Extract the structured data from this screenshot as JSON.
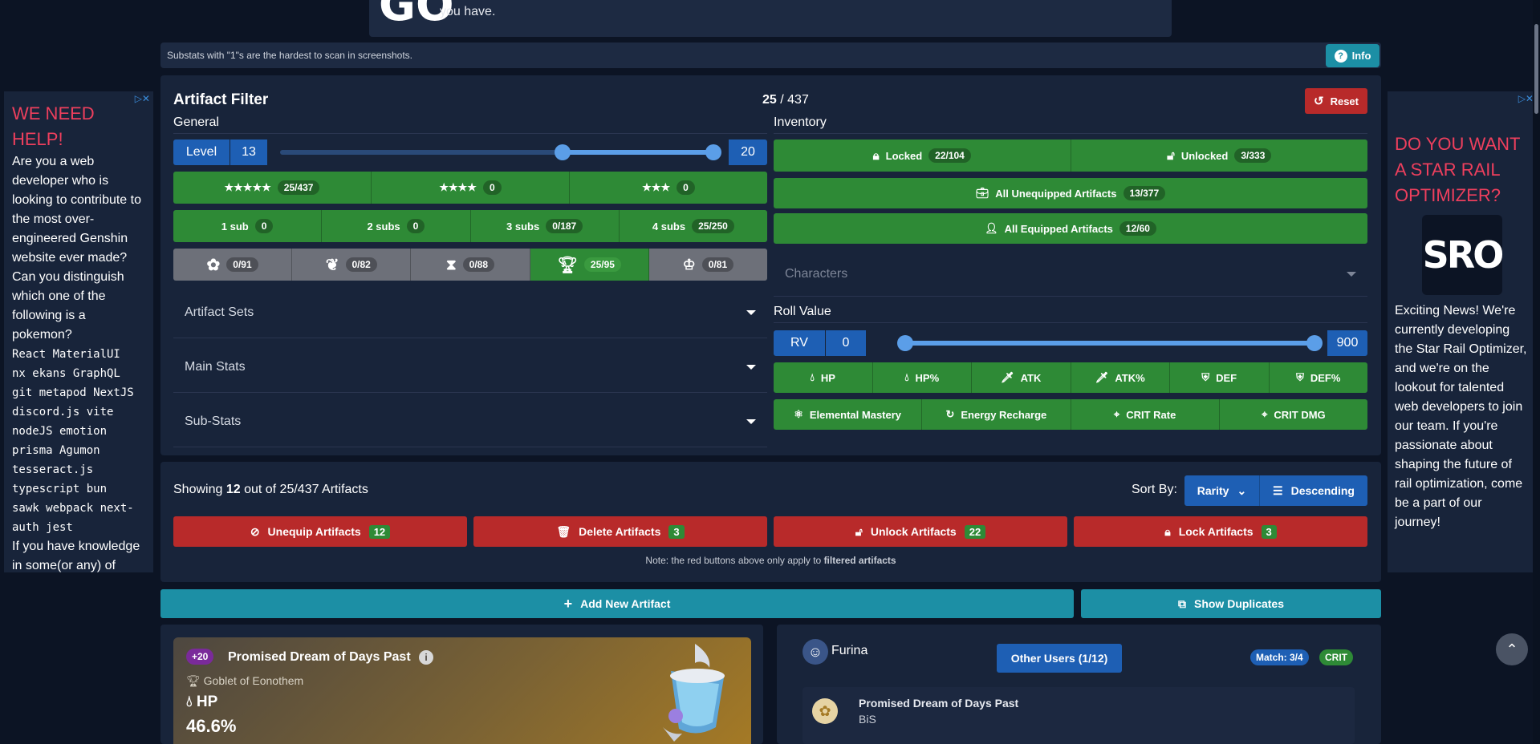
{
  "top_card": {
    "big_text": "GO",
    "text": "you have."
  },
  "alert": {
    "text": "Substats with \"1\"s are the hardest to scan in screenshots.",
    "info_label": "Info"
  },
  "ad_left": {
    "title": "WE NEED HELP!",
    "body": "Are you a web developer who is looking to contribute to the most over-engineered Genshin website ever made? Can you distinguish which one of the following is a pokemon?",
    "mono": [
      "React MaterialUI",
      "nx ekans GraphQL",
      "git metapod NextJS",
      "discord.js vite",
      "nodeJS emotion",
      "prisma Agumon",
      "tesseract.js",
      "typescript bun",
      "sawk webpack next-",
      "auth jest"
    ],
    "tail": "If you have knowledge in some(or any) of"
  },
  "ad_right": {
    "title": "DO YOU WANT A STAR RAIL OPTIMIZER?",
    "logo": "SRO",
    "body": "Exciting News! We're currently developing the Star Rail Optimizer, and we're on the lookout for talented web developers to join our team. If you're passionate about shaping the future of rail optimization, come be a part of our journey!"
  },
  "filter": {
    "title": "Artifact Filter",
    "count_shown": "25",
    "count_sep": " / ",
    "count_total": "437",
    "reset_label": "Reset",
    "general_label": "General",
    "inventory_label": "Inventory",
    "level": {
      "label": "Level",
      "min": "13",
      "max": "20",
      "range_min": 0,
      "range_max": 20
    },
    "rarity": [
      {
        "stars": "★★★★★",
        "count": "25/437"
      },
      {
        "stars": "★★★★",
        "count": "0"
      },
      {
        "stars": "★★★",
        "count": "0"
      }
    ],
    "subs": [
      {
        "label": "1 sub",
        "count": "0"
      },
      {
        "label": "2 subs",
        "count": "0"
      },
      {
        "label": "3 subs",
        "count": "0/187"
      },
      {
        "label": "4 subs",
        "count": "25/250"
      }
    ],
    "slots": [
      {
        "icon": "flower-icon",
        "count": "0/91"
      },
      {
        "icon": "plume-icon",
        "count": "0/82"
      },
      {
        "icon": "sands-icon",
        "count": "0/88"
      },
      {
        "icon": "goblet-icon",
        "count": "25/95"
      },
      {
        "icon": "circlet-icon",
        "count": "0/81"
      }
    ],
    "dropdowns": [
      "Artifact Sets",
      "Main Stats",
      "Sub-Stats"
    ],
    "locked": {
      "label": "Locked",
      "count": "22/104"
    },
    "unlocked": {
      "label": "Unlocked",
      "count": "3/333"
    },
    "unequipped": {
      "label": "All Unequipped Artifacts",
      "count": "13/377"
    },
    "equipped": {
      "label": "All Equipped Artifacts",
      "count": "12/60"
    },
    "characters_placeholder": "Characters",
    "roll_value": {
      "label": "Roll Value",
      "tag": "RV",
      "min": "0",
      "max": "900",
      "range_min": 0,
      "range_max": 900
    },
    "stats_row1": [
      "HP",
      "HP%",
      "ATK",
      "ATK%",
      "DEF",
      "DEF%"
    ],
    "stats_row2": [
      "Elemental Mastery",
      "Energy Recharge",
      "CRIT Rate",
      "CRIT DMG"
    ]
  },
  "results": {
    "showing_prefix": "Showing ",
    "showing_count": "12",
    "showing_suffix": " out of 25/437 Artifacts",
    "sort_by": "Sort By:",
    "sort_field": "Rarity",
    "sort_order": "Descending",
    "actions": [
      {
        "label": "Unequip Artifacts",
        "count": "12"
      },
      {
        "label": "Delete Artifacts",
        "count": "3"
      },
      {
        "label": "Unlock Artifacts",
        "count": "22"
      },
      {
        "label": "Lock Artifacts",
        "count": "3"
      }
    ],
    "note_prefix": "Note: the red buttons above only apply to ",
    "note_bold": "filtered artifacts"
  },
  "add_new": "Add New Artifact",
  "show_duplicates": "Show Duplicates",
  "artifact": {
    "level": "+20",
    "name": "Promised Dream of Days Past",
    "slot": "Goblet of Eonothem",
    "main_stat": "HP",
    "main_value": "46.6%"
  },
  "character_card": {
    "character": "Furina",
    "other_users": "Other Users (1/12)",
    "match": "Match: 3/4",
    "crit": "CRIT",
    "set_name": "Promised Dream of Days Past",
    "set_tag": "BiS"
  },
  "colors": {
    "green": "#2e8a36",
    "blue": "#1e5fb4",
    "red": "#b82a2a",
    "teal": "#1c8fa5",
    "ad_title": "#ee3f5d"
  }
}
